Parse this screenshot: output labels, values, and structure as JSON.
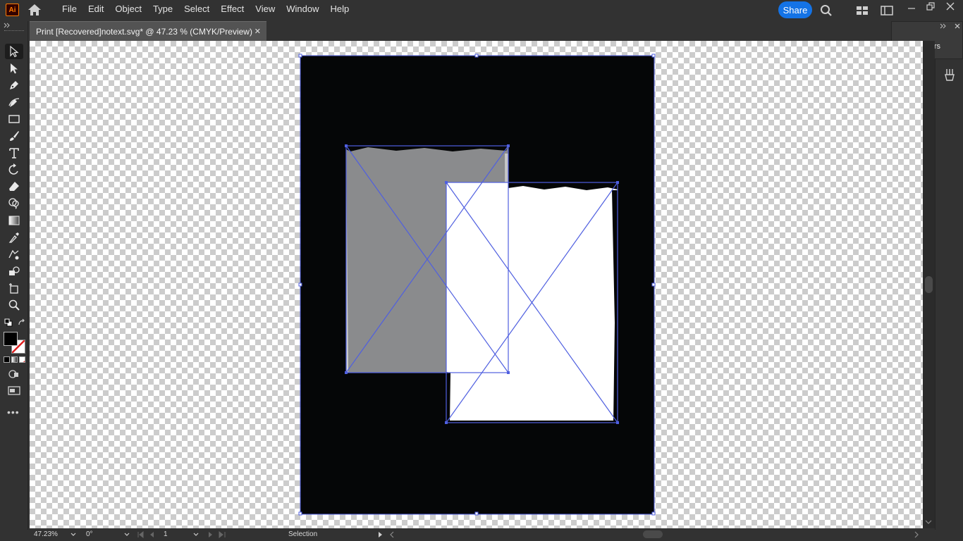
{
  "app": {
    "logo_text": "Ai",
    "accent": "#ff7c00"
  },
  "menu": {
    "items": [
      "File",
      "Edit",
      "Object",
      "Type",
      "Select",
      "Effect",
      "View",
      "Window",
      "Help"
    ]
  },
  "header": {
    "share_label": "Share",
    "share_color": "#1473e6"
  },
  "document": {
    "tab_title": "Print [Recovered]notext.svg* @ 47.23 % (CMYK/Preview)",
    "close_glyph": "✕"
  },
  "panels": {
    "layers_label": "Layers"
  },
  "tools": [
    "selection-tool",
    "direct-selection-tool",
    "pen-tool",
    "curvature-tool",
    "rectangle-tool",
    "paintbrush-tool",
    "type-tool",
    "rotate-tool",
    "eraser-tool",
    "shape-builder-tool",
    "gradient-tool",
    "eyedropper-tool",
    "blend-tool",
    "live-paint-tool",
    "artboard-tool",
    "zoom-tool"
  ],
  "canvas": {
    "artboard_fill": "#050607",
    "gray_image_fill": "#8a8b8d",
    "white_image_fill": "#ffffff",
    "selection_color": "#4f5fe0"
  },
  "status": {
    "zoom": "47.23%",
    "rotation": "0°",
    "artboard": "1",
    "tool": "Selection"
  }
}
